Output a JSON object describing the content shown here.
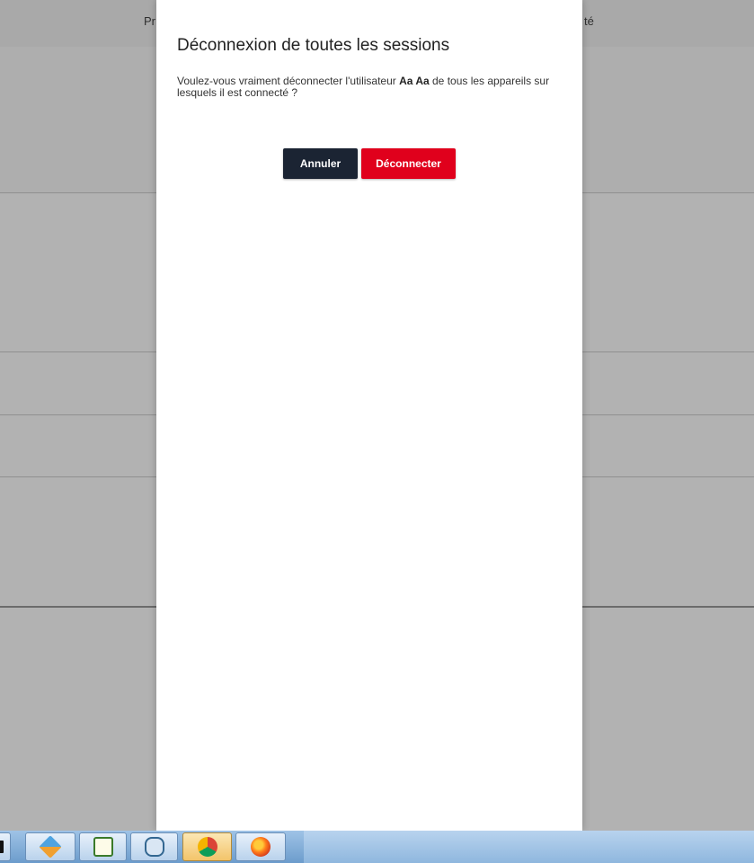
{
  "background": {
    "header_left": "Pr",
    "header_right": "té"
  },
  "modal": {
    "title": "Déconnexion de toutes les sessions",
    "message_before": "Voulez-vous vraiment déconnecter l'utilisateur ",
    "user_name": "Aa Aa",
    "message_after": " de tous les appareils sur lesquels il est connecté ?",
    "cancel_label": "Annuler",
    "confirm_label": "Déconnecter"
  },
  "colors": {
    "cancel_button": "#1b2433",
    "confirm_button": "#e0001c",
    "overlay": "rgba(0,0,0,0.30)"
  },
  "taskbar": {
    "apps": [
      {
        "icon": "terminal-icon"
      },
      {
        "icon": "diamond-app-icon"
      },
      {
        "icon": "chart-editor-icon"
      },
      {
        "icon": "postgresql-elephant-icon"
      },
      {
        "icon": "chrome-icon"
      },
      {
        "icon": "firefox-icon"
      }
    ]
  }
}
